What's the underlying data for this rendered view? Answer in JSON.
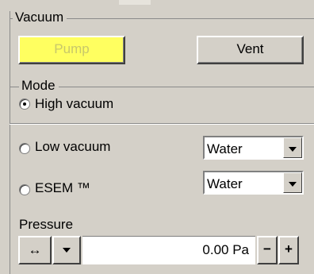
{
  "vacuum": {
    "legend": "Vacuum",
    "pump_label": "Pump",
    "vent_label": "Vent"
  },
  "mode": {
    "legend": "Mode",
    "options": [
      {
        "label": "High vacuum",
        "selected": true
      },
      {
        "label": "Low vacuum",
        "selected": false
      },
      {
        "label": "ESEM ™",
        "selected": false
      }
    ],
    "low_vacuum_gas": "Water",
    "esem_gas": "Water"
  },
  "pressure": {
    "label": "Pressure",
    "value": "0.00 Pa",
    "link_glyph": "↔",
    "minus_label": "−",
    "plus_label": "+"
  },
  "colors": {
    "panel": "#d4d0c8",
    "pump_active": "#ffff60",
    "pump_text": "#c8c86a"
  }
}
